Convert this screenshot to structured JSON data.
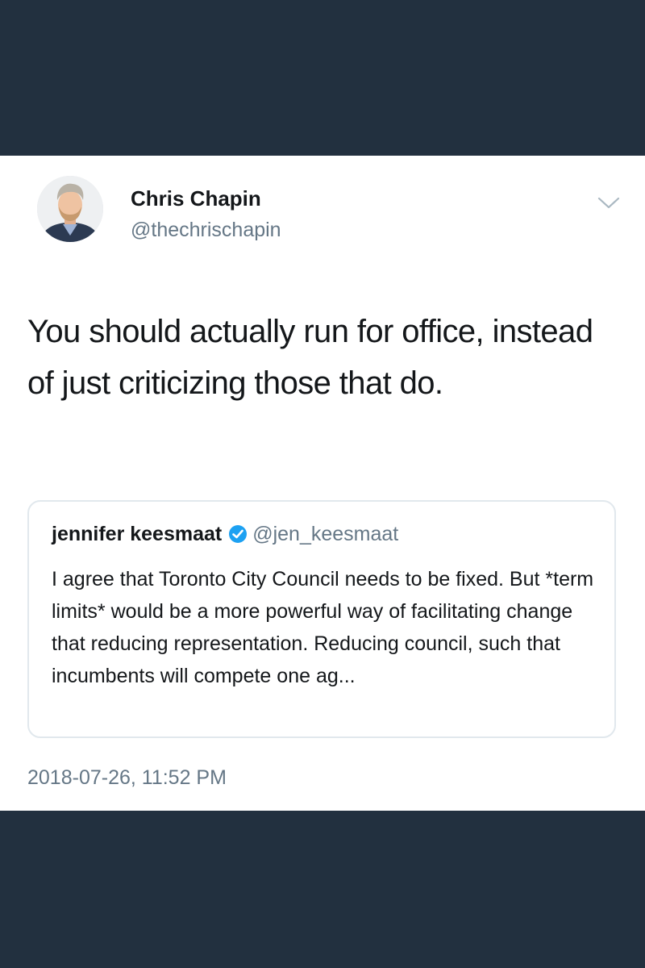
{
  "tweet": {
    "author": {
      "name": "Chris Chapin",
      "handle": "@thechrischapin",
      "avatar_icon": "profile-photo"
    },
    "menu_icon": "chevron-down-icon",
    "text": "You should actually run for office, instead of just criticizing those that do.",
    "timestamp": "2018-07-26, 11:52 PM",
    "quoted": {
      "name": "jennifer keesmaat",
      "verified": true,
      "verified_icon": "verified-badge-icon",
      "verified_color": "#1da1f2",
      "handle": "@jen_keesmaat",
      "text": "I agree that Toronto City Council needs to be fixed. But *term limits* would be a more powerful way of facilitating change that reducing representation. Reducing council, such that incumbents will compete one ag..."
    }
  },
  "colors": {
    "background_band": "#22303f",
    "card": "#ffffff",
    "primary_text": "#14171a",
    "secondary_text": "#657786",
    "border": "#e1e8ed"
  }
}
